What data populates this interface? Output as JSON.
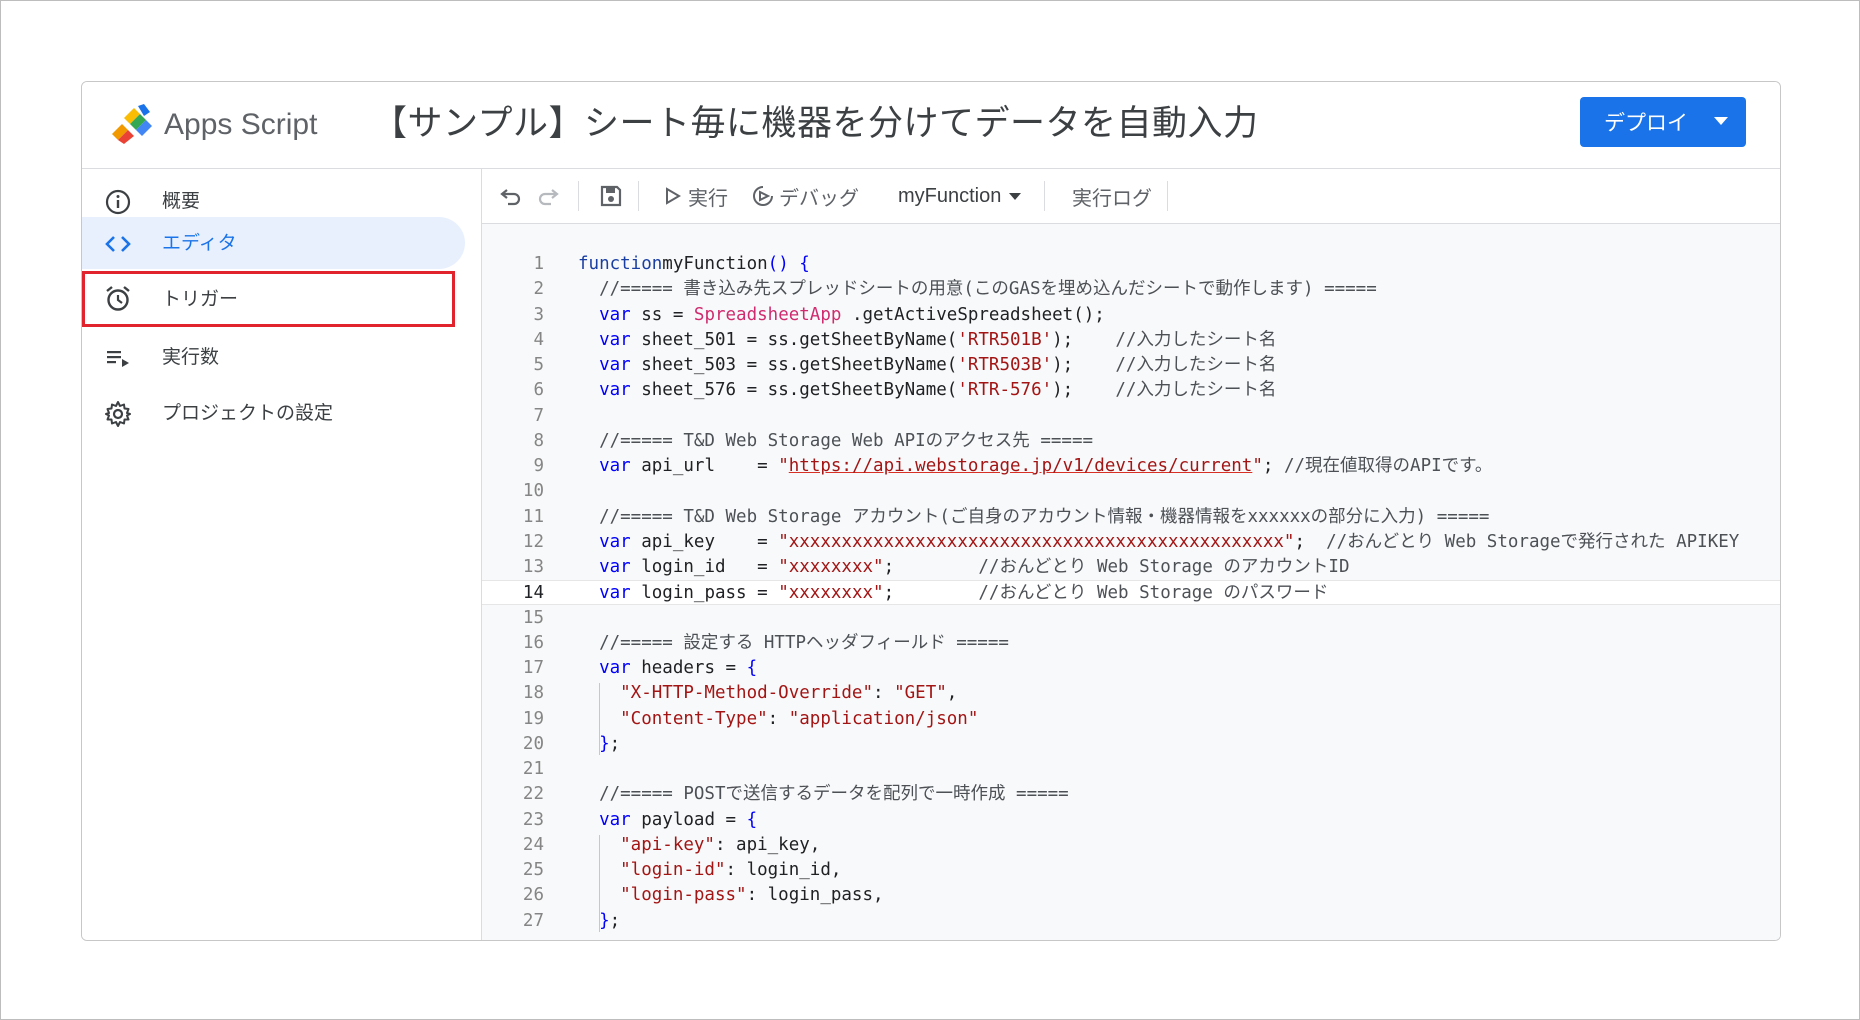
{
  "app": {
    "name": "Apps Script",
    "project_title": "【サンプル】シート毎に機器を分けてデータを自動入力",
    "deploy_label": "デプロイ"
  },
  "sidebar": {
    "items": [
      {
        "label": "概要",
        "icon": "info-icon"
      },
      {
        "label": "エディタ",
        "icon": "code-icon",
        "active": true
      },
      {
        "label": "トリガー",
        "icon": "alarm-clock-icon",
        "highlighted": true
      },
      {
        "label": "実行数",
        "icon": "list-play-icon"
      },
      {
        "label": "プロジェクトの設定",
        "icon": "gear-icon"
      }
    ]
  },
  "toolbar": {
    "run_label": "実行",
    "debug_label": "デバッグ",
    "function_select": "myFunction",
    "log_label": "実行ログ"
  },
  "colors": {
    "accent": "#1a73e8",
    "highlight_box": "#e0232d",
    "active_nav_bg": "#e8f0fe"
  },
  "code": {
    "current_line": 14,
    "lines": [
      [
        [
          "kw2",
          "function"
        ],
        [
          "",
          "myFunction"
        ],
        [
          "kw",
          "()"
        ],
        [
          "kw",
          " {"
        ]
      ],
      [
        [
          "cm",
          "  //===== 書き込み先スプレッドシートの用意(このGASを埋め込んだシートで動作します) ====="
        ]
      ],
      [
        [
          "kw",
          "  var"
        ],
        [
          "",
          " ss = "
        ],
        [
          "cls",
          "SpreadsheetApp"
        ],
        [
          "",
          " .getActiveSpreadsheet();"
        ]
      ],
      [
        [
          "kw",
          "  var"
        ],
        [
          "",
          " sheet_501 = ss.getSheetByName("
        ],
        [
          "str",
          "'RTR501B'"
        ],
        [
          "",
          ");    "
        ],
        [
          "cm",
          "//入力したシート名"
        ]
      ],
      [
        [
          "kw",
          "  var"
        ],
        [
          "",
          " sheet_503 = ss.getSheetByName("
        ],
        [
          "str",
          "'RTR503B'"
        ],
        [
          "",
          ");    "
        ],
        [
          "cm",
          "//入力したシート名"
        ]
      ],
      [
        [
          "kw",
          "  var"
        ],
        [
          "",
          " sheet_576 = ss.getSheetByName("
        ],
        [
          "str",
          "'RTR-576'"
        ],
        [
          "",
          ");    "
        ],
        [
          "cm",
          "//入力したシート名"
        ]
      ],
      [],
      [
        [
          "cm",
          "  //===== T&D Web Storage Web APIのアクセス先 ====="
        ]
      ],
      [
        [
          "kw",
          "  var"
        ],
        [
          "",
          " api_url    = "
        ],
        [
          "str",
          "\""
        ],
        [
          "url",
          "https://api.webstorage.jp/v1/devices/current"
        ],
        [
          "str",
          "\""
        ],
        [
          "",
          "; "
        ],
        [
          "cm",
          "//現在値取得のAPIです。"
        ]
      ],
      [],
      [
        [
          "cm",
          "  //===== T&D Web Storage アカウント(ご自身のアカウント情報・機器情報をxxxxxxの部分に入力) ====="
        ]
      ],
      [
        [
          "kw",
          "  var"
        ],
        [
          "",
          " api_key    = "
        ],
        [
          "str",
          "\"xxxxxxxxxxxxxxxxxxxxxxxxxxxxxxxxxxxxxxxxxxxxxxx\""
        ],
        [
          "",
          ";  "
        ],
        [
          "cm",
          "//おんどとり Web Storageで発行された APIKEY"
        ]
      ],
      [
        [
          "kw",
          "  var"
        ],
        [
          "",
          " login_id   = "
        ],
        [
          "str",
          "\"xxxxxxxx\""
        ],
        [
          "",
          ";        "
        ],
        [
          "cm",
          "//おんどとり Web Storage のアカウントID"
        ]
      ],
      [
        [
          "kw",
          "  var"
        ],
        [
          "",
          " login_pass = "
        ],
        [
          "str",
          "\"xxxxxxxx\""
        ],
        [
          "",
          ";        "
        ],
        [
          "cm",
          "//おんどとり Web Storage のパスワード"
        ]
      ],
      [],
      [
        [
          "cm",
          "  //===== 設定する HTTPヘッダフィールド ====="
        ]
      ],
      [
        [
          "kw",
          "  var"
        ],
        [
          "",
          " headers = "
        ],
        [
          "kw",
          "{"
        ]
      ],
      [
        [
          "str",
          "    \"X-HTTP-Method-Override\""
        ],
        [
          "",
          ": "
        ],
        [
          "str",
          "\"GET\""
        ],
        [
          "",
          ","
        ]
      ],
      [
        [
          "str",
          "    \"Content-Type\""
        ],
        [
          "",
          ": "
        ],
        [
          "str",
          "\"application/json\""
        ]
      ],
      [
        [
          "kw",
          "  }"
        ],
        [
          "",
          ";"
        ]
      ],
      [],
      [
        [
          "cm",
          "  //===== POSTで送信するデータを配列で一時作成 ====="
        ]
      ],
      [
        [
          "kw",
          "  var"
        ],
        [
          "",
          " payload = "
        ],
        [
          "kw",
          "{"
        ]
      ],
      [
        [
          "str",
          "    \"api-key\""
        ],
        [
          "",
          ": api_key,"
        ]
      ],
      [
        [
          "str",
          "    \"login-id\""
        ],
        [
          "",
          ": login_id,"
        ]
      ],
      [
        [
          "str",
          "    \"login-pass\""
        ],
        [
          "",
          ": login_pass,"
        ]
      ],
      [
        [
          "kw",
          "  }"
        ],
        [
          "",
          ";"
        ]
      ]
    ]
  }
}
